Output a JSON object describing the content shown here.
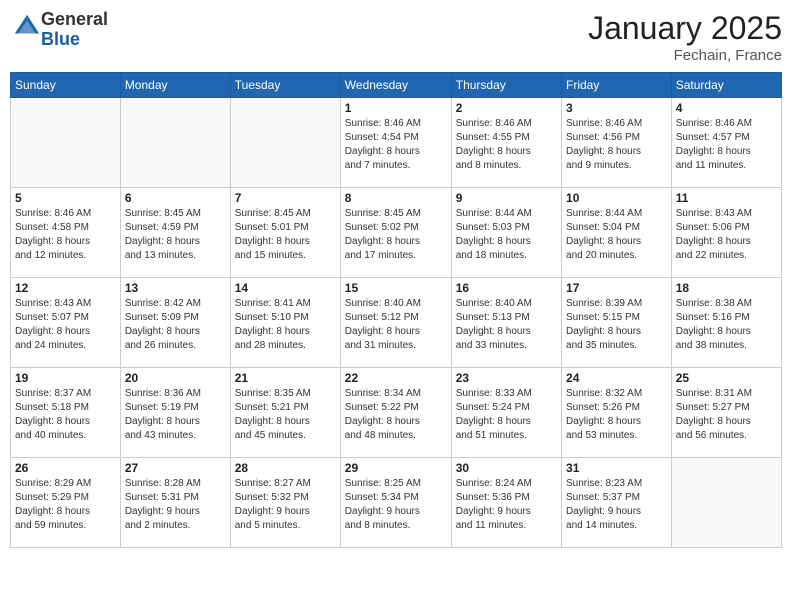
{
  "logo": {
    "general": "General",
    "blue": "Blue"
  },
  "header": {
    "month": "January 2025",
    "location": "Fechain, France"
  },
  "weekdays": [
    "Sunday",
    "Monday",
    "Tuesday",
    "Wednesday",
    "Thursday",
    "Friday",
    "Saturday"
  ],
  "weeks": [
    [
      {
        "day": "",
        "info": ""
      },
      {
        "day": "",
        "info": ""
      },
      {
        "day": "",
        "info": ""
      },
      {
        "day": "1",
        "info": "Sunrise: 8:46 AM\nSunset: 4:54 PM\nDaylight: 8 hours\nand 7 minutes."
      },
      {
        "day": "2",
        "info": "Sunrise: 8:46 AM\nSunset: 4:55 PM\nDaylight: 8 hours\nand 8 minutes."
      },
      {
        "day": "3",
        "info": "Sunrise: 8:46 AM\nSunset: 4:56 PM\nDaylight: 8 hours\nand 9 minutes."
      },
      {
        "day": "4",
        "info": "Sunrise: 8:46 AM\nSunset: 4:57 PM\nDaylight: 8 hours\nand 11 minutes."
      }
    ],
    [
      {
        "day": "5",
        "info": "Sunrise: 8:46 AM\nSunset: 4:58 PM\nDaylight: 8 hours\nand 12 minutes."
      },
      {
        "day": "6",
        "info": "Sunrise: 8:45 AM\nSunset: 4:59 PM\nDaylight: 8 hours\nand 13 minutes."
      },
      {
        "day": "7",
        "info": "Sunrise: 8:45 AM\nSunset: 5:01 PM\nDaylight: 8 hours\nand 15 minutes."
      },
      {
        "day": "8",
        "info": "Sunrise: 8:45 AM\nSunset: 5:02 PM\nDaylight: 8 hours\nand 17 minutes."
      },
      {
        "day": "9",
        "info": "Sunrise: 8:44 AM\nSunset: 5:03 PM\nDaylight: 8 hours\nand 18 minutes."
      },
      {
        "day": "10",
        "info": "Sunrise: 8:44 AM\nSunset: 5:04 PM\nDaylight: 8 hours\nand 20 minutes."
      },
      {
        "day": "11",
        "info": "Sunrise: 8:43 AM\nSunset: 5:06 PM\nDaylight: 8 hours\nand 22 minutes."
      }
    ],
    [
      {
        "day": "12",
        "info": "Sunrise: 8:43 AM\nSunset: 5:07 PM\nDaylight: 8 hours\nand 24 minutes."
      },
      {
        "day": "13",
        "info": "Sunrise: 8:42 AM\nSunset: 5:09 PM\nDaylight: 8 hours\nand 26 minutes."
      },
      {
        "day": "14",
        "info": "Sunrise: 8:41 AM\nSunset: 5:10 PM\nDaylight: 8 hours\nand 28 minutes."
      },
      {
        "day": "15",
        "info": "Sunrise: 8:40 AM\nSunset: 5:12 PM\nDaylight: 8 hours\nand 31 minutes."
      },
      {
        "day": "16",
        "info": "Sunrise: 8:40 AM\nSunset: 5:13 PM\nDaylight: 8 hours\nand 33 minutes."
      },
      {
        "day": "17",
        "info": "Sunrise: 8:39 AM\nSunset: 5:15 PM\nDaylight: 8 hours\nand 35 minutes."
      },
      {
        "day": "18",
        "info": "Sunrise: 8:38 AM\nSunset: 5:16 PM\nDaylight: 8 hours\nand 38 minutes."
      }
    ],
    [
      {
        "day": "19",
        "info": "Sunrise: 8:37 AM\nSunset: 5:18 PM\nDaylight: 8 hours\nand 40 minutes."
      },
      {
        "day": "20",
        "info": "Sunrise: 8:36 AM\nSunset: 5:19 PM\nDaylight: 8 hours\nand 43 minutes."
      },
      {
        "day": "21",
        "info": "Sunrise: 8:35 AM\nSunset: 5:21 PM\nDaylight: 8 hours\nand 45 minutes."
      },
      {
        "day": "22",
        "info": "Sunrise: 8:34 AM\nSunset: 5:22 PM\nDaylight: 8 hours\nand 48 minutes."
      },
      {
        "day": "23",
        "info": "Sunrise: 8:33 AM\nSunset: 5:24 PM\nDaylight: 8 hours\nand 51 minutes."
      },
      {
        "day": "24",
        "info": "Sunrise: 8:32 AM\nSunset: 5:26 PM\nDaylight: 8 hours\nand 53 minutes."
      },
      {
        "day": "25",
        "info": "Sunrise: 8:31 AM\nSunset: 5:27 PM\nDaylight: 8 hours\nand 56 minutes."
      }
    ],
    [
      {
        "day": "26",
        "info": "Sunrise: 8:29 AM\nSunset: 5:29 PM\nDaylight: 8 hours\nand 59 minutes."
      },
      {
        "day": "27",
        "info": "Sunrise: 8:28 AM\nSunset: 5:31 PM\nDaylight: 9 hours\nand 2 minutes."
      },
      {
        "day": "28",
        "info": "Sunrise: 8:27 AM\nSunset: 5:32 PM\nDaylight: 9 hours\nand 5 minutes."
      },
      {
        "day": "29",
        "info": "Sunrise: 8:25 AM\nSunset: 5:34 PM\nDaylight: 9 hours\nand 8 minutes."
      },
      {
        "day": "30",
        "info": "Sunrise: 8:24 AM\nSunset: 5:36 PM\nDaylight: 9 hours\nand 11 minutes."
      },
      {
        "day": "31",
        "info": "Sunrise: 8:23 AM\nSunset: 5:37 PM\nDaylight: 9 hours\nand 14 minutes."
      },
      {
        "day": "",
        "info": ""
      }
    ]
  ]
}
